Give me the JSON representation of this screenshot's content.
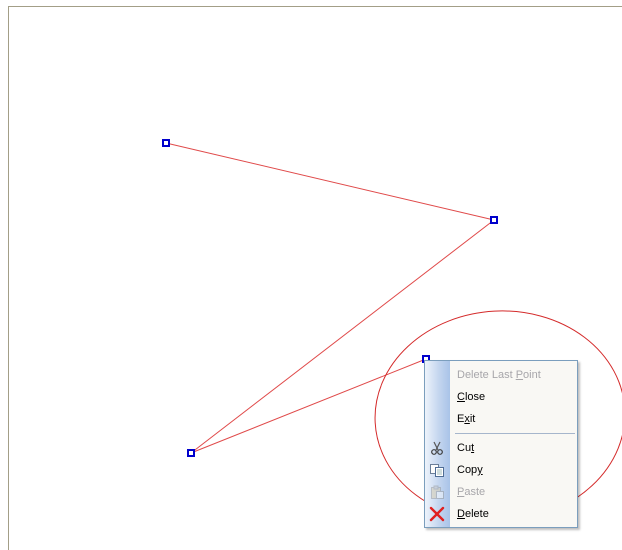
{
  "context_menu": {
    "items": [
      {
        "pre": "Delete Last ",
        "key": "P",
        "post": "oint",
        "enabled": false,
        "icon": "none"
      },
      {
        "pre": "",
        "key": "C",
        "post": "lose",
        "enabled": true,
        "icon": "none"
      },
      {
        "pre": "E",
        "key": "x",
        "post": "it",
        "enabled": true,
        "icon": "none"
      },
      {
        "pre": "Cu",
        "key": "t",
        "post": "",
        "enabled": true,
        "icon": "scissors-icon"
      },
      {
        "pre": "Cop",
        "key": "y",
        "post": "",
        "enabled": true,
        "icon": "copy-icon"
      },
      {
        "pre": "",
        "key": "P",
        "post": "aste",
        "enabled": false,
        "icon": "paste-icon"
      },
      {
        "pre": "",
        "key": "D",
        "post": "elete",
        "enabled": true,
        "icon": "delete-x-icon"
      }
    ]
  },
  "colors": {
    "polyline": "#e04a4a",
    "vertex": "#0000cc",
    "highlight_ellipse": "#d42a2a",
    "menu_border": "#7b9ebd"
  }
}
